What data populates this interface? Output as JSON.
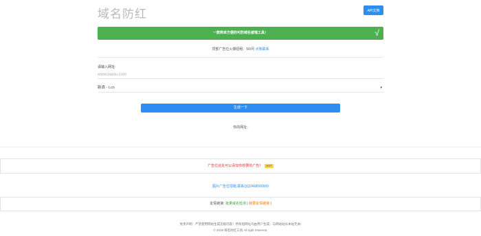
{
  "header": {
    "site_title": "域名防红",
    "api_button": "API文档"
  },
  "banner": {
    "text": "一款简单方便的可防域名被墙工具！",
    "check_icon": "√"
  },
  "ad": {
    "prefix": "顶部广告位火爆招租：50/月",
    "link": "点我联系"
  },
  "form": {
    "url_label": "请输入网址:",
    "url_placeholder": "www.baidu.com",
    "select_value": "新浪 - t.cn",
    "generate_button": "生成一下",
    "result_label": "你的网址:"
  },
  "ad_box": {
    "text": "广告位此处可以添加你想要的广告！",
    "badge": "HOT"
  },
  "contact": {
    "text": "图片广告位招租,联系QQ2468000999"
  },
  "links_box": {
    "prefix": "友情链接:",
    "link1": "批量域名检测",
    "separator": "|",
    "link2": "我要友情链接",
    "suffix": "|"
  },
  "footer": {
    "disclaimer": "免责声明：严禁使用网站生成违规内容！所有短网址均由用户生成，与网站站长本站无关!",
    "copyright": "© 2019 域名防红工具 All right reserved."
  },
  "colors": {
    "primary": "#2d8ef2",
    "success": "#4caf50",
    "danger": "#e53935"
  }
}
